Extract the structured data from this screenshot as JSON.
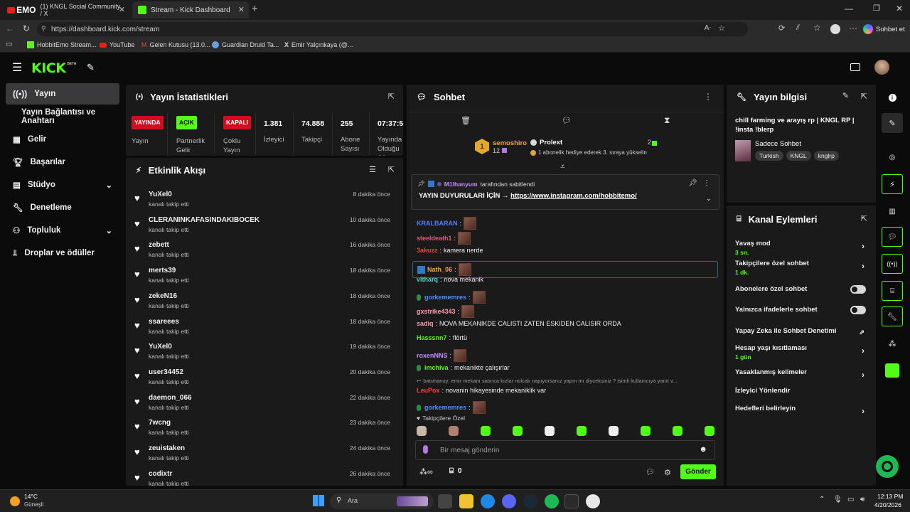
{
  "browser": {
    "tabs": [
      {
        "title": "(1) KNGL Social Community / X",
        "overlay": "EMO"
      },
      {
        "title": "Stream - Kick Dashboard"
      }
    ],
    "url": "https://dashboard.kick.com/stream",
    "profile_label": "Sohbet et",
    "bookmarks": [
      "HobbitEmo Stream...",
      "YouTube",
      "Gelen Kutusu (13.0...",
      "Guardian Druid Ta...",
      "Emir Yalçınkaya (@..."
    ]
  },
  "header": {
    "logo": "KICK",
    "beta": "BETA"
  },
  "sidebar": {
    "items": [
      {
        "label": "Yayın",
        "active": true
      },
      {
        "label": "Yayın Bağlantısı ve Anahtarı"
      },
      {
        "label": "Gelir"
      },
      {
        "label": "Başarılar"
      },
      {
        "label": "Stüdyo"
      },
      {
        "label": "Denetleme"
      },
      {
        "label": "Topluluk"
      },
      {
        "label": "Droplar ve ödüller"
      }
    ]
  },
  "stats": {
    "title": "Yayın İstatistikleri",
    "items": [
      {
        "badge": "YAYINDA",
        "label": "Yayın",
        "color": "#d10d1f"
      },
      {
        "badge": "AÇIK",
        "label": "Partnerlik Gelir",
        "color": "#53fc18"
      },
      {
        "badge": "KAPALI",
        "label": "Çoklu Yayın",
        "color": "#d10d1f"
      },
      {
        "value": "1.381",
        "label": "İzleyici"
      },
      {
        "value": "74.888",
        "label": "Takipçi"
      },
      {
        "value": "255",
        "label": "Abone Sayısı"
      },
      {
        "value": "07:37:55",
        "label": "Yayında Olduğu Süre"
      }
    ]
  },
  "activity": {
    "title": "Etkinlik Akışı",
    "events": [
      {
        "name": "YuXel0",
        "sub": "kanalı takip etti",
        "time": "8 dakika önce"
      },
      {
        "name": "CLERANINKAFASINDAKIBOCEK",
        "sub": "kanalı takip etti",
        "time": "10 dakika önce"
      },
      {
        "name": "zebett",
        "sub": "kanalı takip etti",
        "time": "16 dakika önce"
      },
      {
        "name": "merts39",
        "sub": "kanalı takip etti",
        "time": "18 dakika önce"
      },
      {
        "name": "zekeN16",
        "sub": "kanalı takip etti",
        "time": "18 dakika önce"
      },
      {
        "name": "ssareees",
        "sub": "kanalı takip etti",
        "time": "18 dakika önce"
      },
      {
        "name": "YuXel0",
        "sub": "kanalı takip etti",
        "time": "19 dakika önce"
      },
      {
        "name": "user34452",
        "sub": "kanalı takip etti",
        "time": "20 dakika önce"
      },
      {
        "name": "daemon_066",
        "sub": "kanalı takip etti",
        "time": "22 dakika önce"
      },
      {
        "name": "7wcng",
        "sub": "kanalı takip etti",
        "time": "23 dakika önce"
      },
      {
        "name": "zeuistaken",
        "sub": "kanalı takip etti",
        "time": "24 dakika önce"
      },
      {
        "name": "codixtr",
        "sub": "kanalı takip etti",
        "time": "26 dakika önce"
      }
    ]
  },
  "chat": {
    "title": "Sohbet",
    "leader1": {
      "name": "semoshiro",
      "rank": "1",
      "count": "12"
    },
    "leader2": {
      "name": "Prolext",
      "count": "2",
      "note": "1 abonelik hediye ederek 3. sıraya yükselin"
    },
    "pinned": {
      "by": "M1lhanyum",
      "by_suffix": "tarafından sabitlendi",
      "text": "YAYIN DUYURULARI İÇİN → ",
      "link": "https://www.instagram.com/hobbitemo/"
    },
    "messages": [
      {
        "user": "KRALBARAN",
        "text": "",
        "color": "#4f7fff",
        "emote": true
      },
      {
        "user": "steeldeath1",
        "text": "",
        "color": "#e05a7a",
        "emote": true
      },
      {
        "user": "3akuzz",
        "text": "kamera nerde",
        "color": "#ff3b3b"
      },
      {
        "user": "Nath_06",
        "text": "",
        "color": "#f3a634",
        "emote": true
      },
      {
        "user": "vitharq",
        "text": "nova mekanik",
        "color": "#4fd1c5"
      },
      {
        "user": "gorkememres",
        "text": "",
        "color": "#4f8fff",
        "emote": true
      },
      {
        "user": "gxstrike4343",
        "text": "",
        "color": "#ff9ab0",
        "emote": true
      },
      {
        "user": "sadiq",
        "text": "NOVA MEKANIKDE CALISTI ZATEN ESKIDEN CALISIR ORDA",
        "color": "#ff9ab0"
      },
      {
        "user": "Hasssnn7",
        "text": "flörtü",
        "color": "#53fc18"
      },
      {
        "user": "roxenNNS",
        "text": "",
        "color": "#c58cff",
        "emote": true
      },
      {
        "user": "imchiva",
        "text": "mekanikte çalışırlar",
        "color": "#53fc18"
      },
      {
        "reply": "batuhanuy: emir mekanı satınca kızlar nolcak napıyorsanız yapın mı diyceksiniz ? isimli kullanıcıya yanıt v..."
      },
      {
        "user": "LeuPox",
        "text": "novanin hikayesinde mekaniklik var",
        "color": "#ff3b3b"
      },
      {
        "user": "gorkememres",
        "text": "",
        "color": "#4f8fff",
        "emote": true
      }
    ],
    "followers_only": "Takipçilere Özel",
    "input_placeholder": "Bir mesaj gönderin",
    "points": "0",
    "send_label": "Gönder"
  },
  "info": {
    "title": "Yayın bilgisi",
    "stream_title": "chill farming ve arayış rp | KNGL RP | !insta !blerp",
    "mode": "Sadece Sohbet",
    "tags": [
      "Turkish",
      "KNGL",
      "knglrp"
    ]
  },
  "actions": {
    "title": "Kanal Eylemleri",
    "rows": [
      {
        "label": "Yavaş mod",
        "sub": "3 sn.",
        "ctl": "chev"
      },
      {
        "label": "Takipçilere özel sohbet",
        "sub": "1 dk.",
        "ctl": "chev"
      },
      {
        "label": "Abonelere özel sohbet",
        "ctl": "toggle"
      },
      {
        "label": "Yalnızca ifadelerle sohbet",
        "ctl": "toggle"
      },
      {
        "label": "Yapay Zeka ile Sohbet Denetimi",
        "ctl": "ext"
      },
      {
        "label": "Hesap yaşı kısıtlaması",
        "sub": "1 gün",
        "ctl": "chev"
      },
      {
        "label": "Yasaklanmış kelimeler",
        "ctl": "chev"
      },
      {
        "label": "İzleyici Yönlendir",
        "ctl": "none"
      },
      {
        "label": "Hedefleri belirleyin",
        "ctl": "chev"
      }
    ]
  },
  "taskbar": {
    "weather_temp": "14°C",
    "weather_desc": "Güneşli",
    "search": "Ara",
    "time": "12:13 PM",
    "date": "4/20/2026"
  },
  "colors": {
    "accent": "#53fc18",
    "live": "#d10d1f",
    "panel": "#1a1a1b"
  }
}
